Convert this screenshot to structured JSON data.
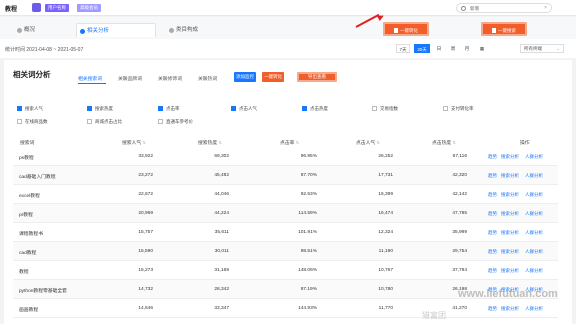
{
  "app": {
    "title": "教程",
    "badge_primary": "用户名称",
    "badge_secondary": "高级会员"
  },
  "search": {
    "value": "新增"
  },
  "tabs": [
    {
      "label": "概况"
    },
    {
      "label": "相关分析"
    },
    {
      "label": "类目构成"
    }
  ],
  "date_filter": {
    "range_text": "统计时间 2021-04-08 ~ 2021-05-07",
    "periods": [
      "7天",
      "30天",
      "日",
      "周",
      "月"
    ],
    "active_period": "30天",
    "device": "所有终端"
  },
  "export_buttons": {
    "primary": "一键转化",
    "secondary": "一键搜索"
  },
  "section": {
    "title": "相关词分析",
    "subtabs": [
      "相关搜索词",
      "关联品牌词",
      "关联修饰词",
      "关联热词"
    ],
    "active_subtab": "相关搜索词",
    "actions": [
      "添加监控",
      "一键转化",
      "导出查看"
    ]
  },
  "metrics": [
    {
      "label": "搜索人气",
      "checked": true
    },
    {
      "label": "搜索热度",
      "checked": true
    },
    {
      "label": "点击率",
      "checked": true
    },
    {
      "label": "点击人气",
      "checked": true
    },
    {
      "label": "点击热度",
      "checked": true
    },
    {
      "label": "交易指数",
      "checked": false
    },
    {
      "label": "支付转化率",
      "checked": false
    },
    {
      "label": "在线商品数",
      "checked": false
    },
    {
      "label": "商城点击占比",
      "checked": false
    },
    {
      "label": "直通车参考价",
      "checked": false
    }
  ],
  "table": {
    "headers": [
      "搜索词",
      "搜索人气",
      "搜索热度",
      "点击率",
      "点击人气",
      "点击热度",
      "操作"
    ],
    "rows": [
      {
        "word": "ps教程",
        "pop": "33,922",
        "heat": "69,302",
        "ctr": "96.95%",
        "cpop": "26,252",
        "cheat": "67,116",
        "ops": [
          "趋势",
          "搜索分析",
          "人群分析"
        ]
      },
      {
        "word": "cad基础入门教程",
        "pop": "23,272",
        "heat": "45,482",
        "ctr": "87.70%",
        "cpop": "17,731",
        "cheat": "42,320",
        "ops": [
          "趋势",
          "搜索分析",
          "人群分析"
        ]
      },
      {
        "word": "excel教程",
        "pop": "22,672",
        "heat": "44,046",
        "ctr": "92.53%",
        "cpop": "16,399",
        "cheat": "42,142",
        "ops": [
          "趋势",
          "搜索分析",
          "人群分析"
        ]
      },
      {
        "word": "pr教程",
        "pop": "20,969",
        "heat": "44,224",
        "ctr": "114.59%",
        "cpop": "16,474",
        "cheat": "47,785",
        "ops": [
          "趋势",
          "搜索分析",
          "人群分析"
        ]
      },
      {
        "word": "课程教程书",
        "pop": "15,757",
        "heat": "35,611",
        "ctr": "101.91%",
        "cpop": "12,324",
        "cheat": "35,999",
        "ops": [
          "趋势",
          "搜索分析",
          "人群分析"
        ]
      },
      {
        "word": "cad教程",
        "pop": "15,590",
        "heat": "30,011",
        "ctr": "98.51%",
        "cpop": "11,190",
        "cheat": "29,754",
        "ops": [
          "趋势",
          "搜索分析",
          "人群分析"
        ]
      },
      {
        "word": "教程",
        "pop": "15,273",
        "heat": "31,169",
        "ctr": "148.06%",
        "cpop": "10,767",
        "cheat": "37,784",
        "ops": [
          "趋势",
          "搜索分析",
          "人群分析"
        ]
      },
      {
        "word": "python教程零基础全套",
        "pop": "14,732",
        "heat": "28,342",
        "ctr": "87.19%",
        "cpop": "10,780",
        "cheat": "26,198",
        "ops": [
          "趋势",
          "搜索分析",
          "人群分析"
        ]
      },
      {
        "word": "画画教程",
        "pop": "14,646",
        "heat": "33,347",
        "ctr": "144.93%",
        "cpop": "11,770",
        "cheat": "41,270",
        "ops": [
          "趋势",
          "搜索分析",
          "人群分析"
        ]
      }
    ]
  },
  "watermark": {
    "url": "www.liefutuan.com",
    "cn": "猎富团"
  },
  "colors": {
    "accent": "#1677ff",
    "orange": "#f25d2a",
    "purple": "#7b61ff"
  }
}
